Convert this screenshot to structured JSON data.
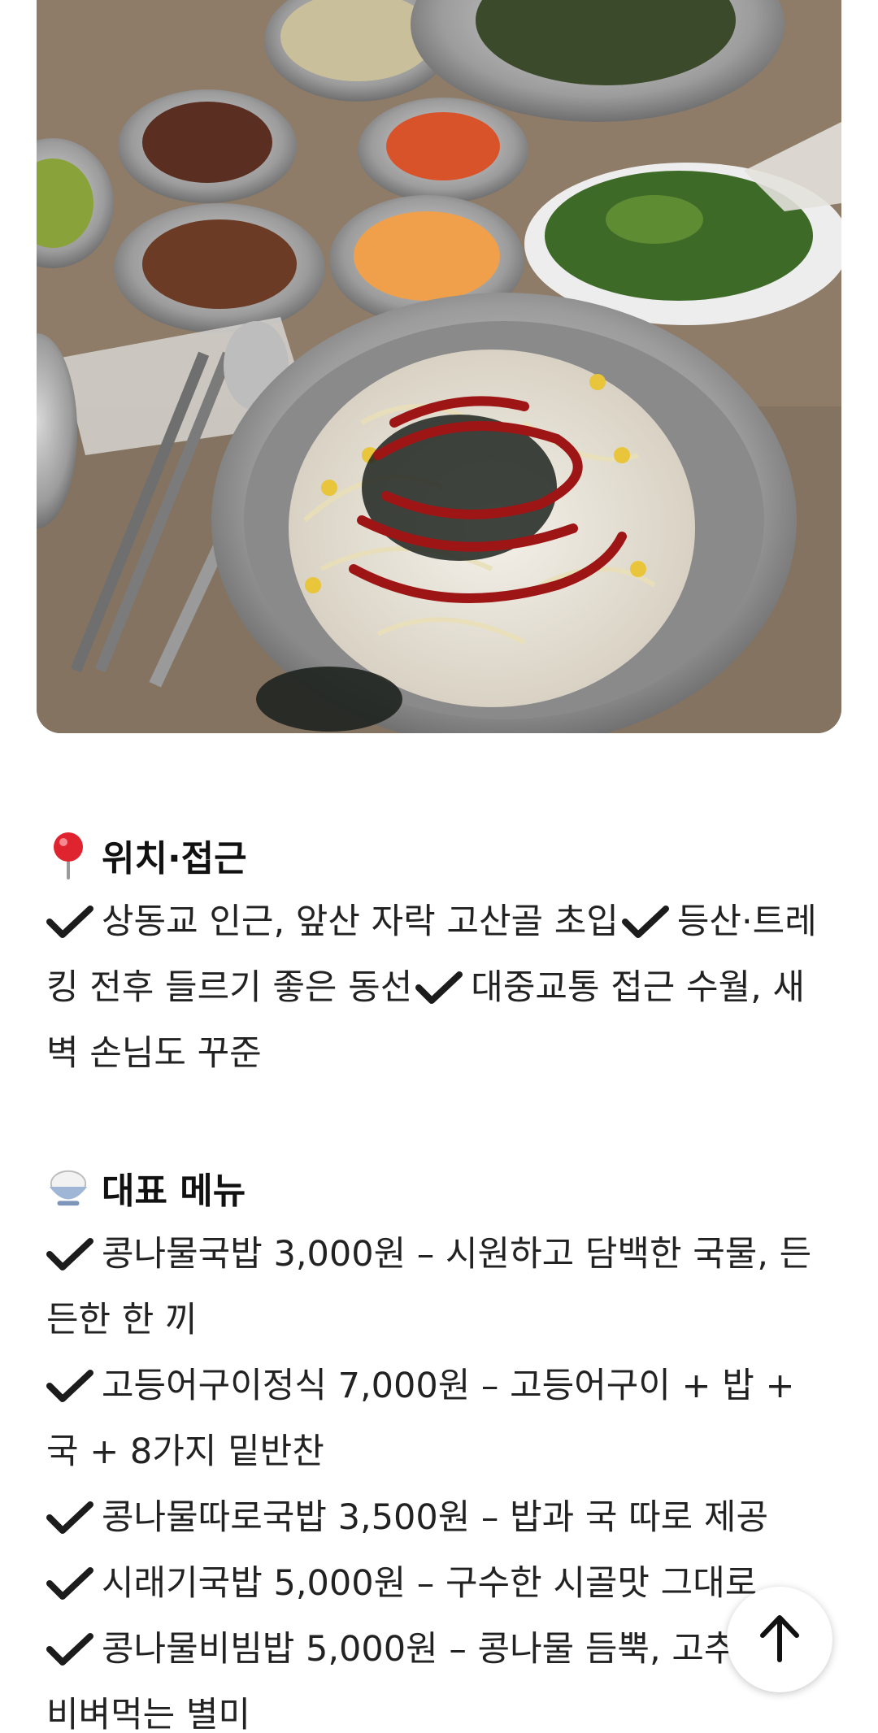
{
  "photo": {
    "alt_icon": "food-photo"
  },
  "location_section": {
    "emoji": "round-pushpin-icon",
    "title": "위치·접근",
    "items": [
      "상동교 인근, 앞산 자락 고산골 초입",
      "등산·트레킹 전후 들르기 좋은 동선",
      "대중교통 접근 수월, 새벽 손님도 꾸준"
    ]
  },
  "menu_section": {
    "emoji": "rice-bowl-icon",
    "title": "대표 메뉴",
    "items": [
      "콩나물국밥 3,000원 – 시원하고 담백한 국물, 든든한 한 끼",
      "고등어구이정식 7,000원 – 고등어구이 + 밥 + 국 + 8가지 밑반찬",
      "콩나물따로국밥 3,500원 – 밥과 국 따로 제공",
      "시래기국밥 5,000원 – 구수한 시골맛 그대로",
      "콩나물비빔밥 5,000원 – 콩나물 듬뿍, 고추장에 비벼먹는 별미"
    ]
  },
  "colors": {
    "check": "#1c1c1c",
    "heading": "#111111",
    "body_text": "#222222",
    "pin_red": "#e0242f"
  },
  "fab": {
    "icon": "arrow-up-icon"
  }
}
